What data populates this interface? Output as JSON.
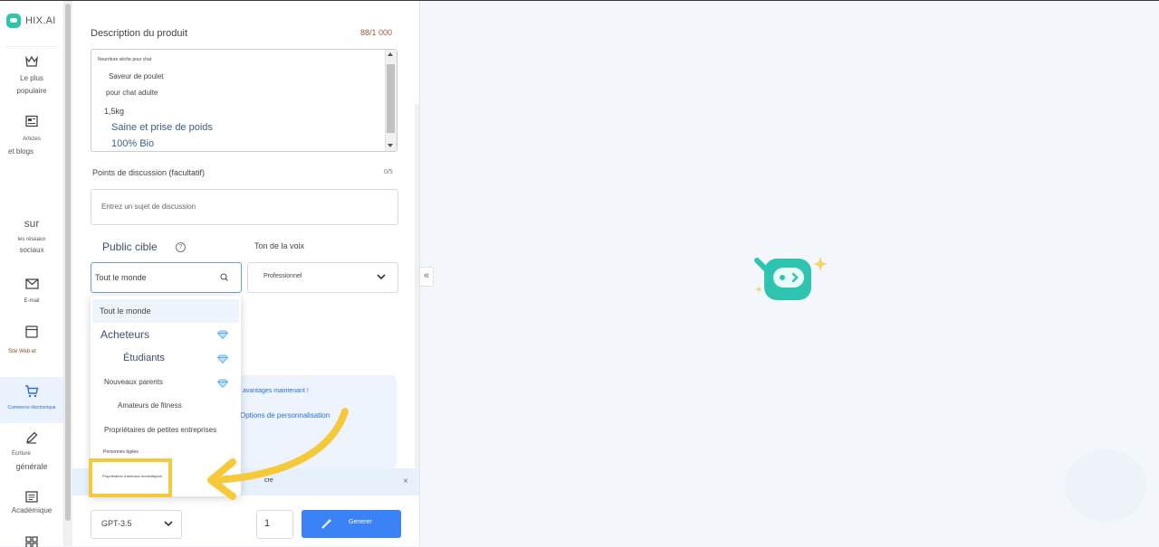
{
  "sidebar": {
    "brand": "HIX.AI",
    "items": [
      {
        "icon": "crown-icon",
        "label1": "Le plus",
        "label2": "populaire"
      },
      {
        "icon": "article-icon",
        "label1": "Articles",
        "label2": "et blogs"
      },
      {
        "icon": "",
        "label1": "",
        "label2": ""
      },
      {
        "icon": "",
        "label1": "sur",
        "label2": "les réseaux",
        "label3": "sociaux"
      },
      {
        "icon": "mail-icon",
        "label1": "E-mail",
        "label2": ""
      },
      {
        "icon": "browser-icon",
        "label1": "Site Web et",
        "label2": ""
      },
      {
        "icon": "cart-icon",
        "label1": "Commerce électronique",
        "label2": ""
      },
      {
        "icon": "pen-icon",
        "label1": "Écriture",
        "label2": "générale"
      },
      {
        "icon": "document-icon",
        "label1": "Académique",
        "label2": ""
      }
    ]
  },
  "form": {
    "description_label": "Description du produit",
    "description_counter": "88/1 000",
    "description_lines": [
      "Nourriture sèche pour chat",
      "Saveur de poulet",
      "pour chat adulte",
      "1,5kg",
      "Saine et prise de poids",
      "100% Bio"
    ],
    "points_label": "Points de discussion (facultatif)",
    "points_counter": "0/5",
    "points_placeholder": "Entrez un sujet de discussion",
    "audience_label": "Public cible",
    "audience_value": "Tout le monde",
    "tone_label": "Ton de la voix",
    "tone_value": "Professionnel"
  },
  "audience_options": [
    {
      "label": "Tout le monde",
      "premium": false
    },
    {
      "label": "Acheteurs",
      "premium": true
    },
    {
      "label": "Étudiants",
      "premium": true
    },
    {
      "label": "Nouveaux parents",
      "premium": true
    },
    {
      "label": "Amateurs de fitness",
      "premium": false
    },
    {
      "label": "Propriétaires de petites entreprises",
      "premium": false
    },
    {
      "label": "Personnes âgées",
      "premium": false
    },
    {
      "label": "Propriétaires d'animaux domestiques",
      "premium": false
    }
  ],
  "info_card": {
    "line1": "avantages maintenant !",
    "line2": "Options de personnalisation"
  },
  "bottom_bar": {
    "text": "cre",
    "close": "×"
  },
  "footer": {
    "model": "GPT-3.5",
    "count": "1",
    "generate": "Generer"
  },
  "collapse": "«",
  "colors": {
    "accent": "#3b82f6",
    "brand": "#2ec4b0",
    "highlight": "#f6c93a"
  }
}
